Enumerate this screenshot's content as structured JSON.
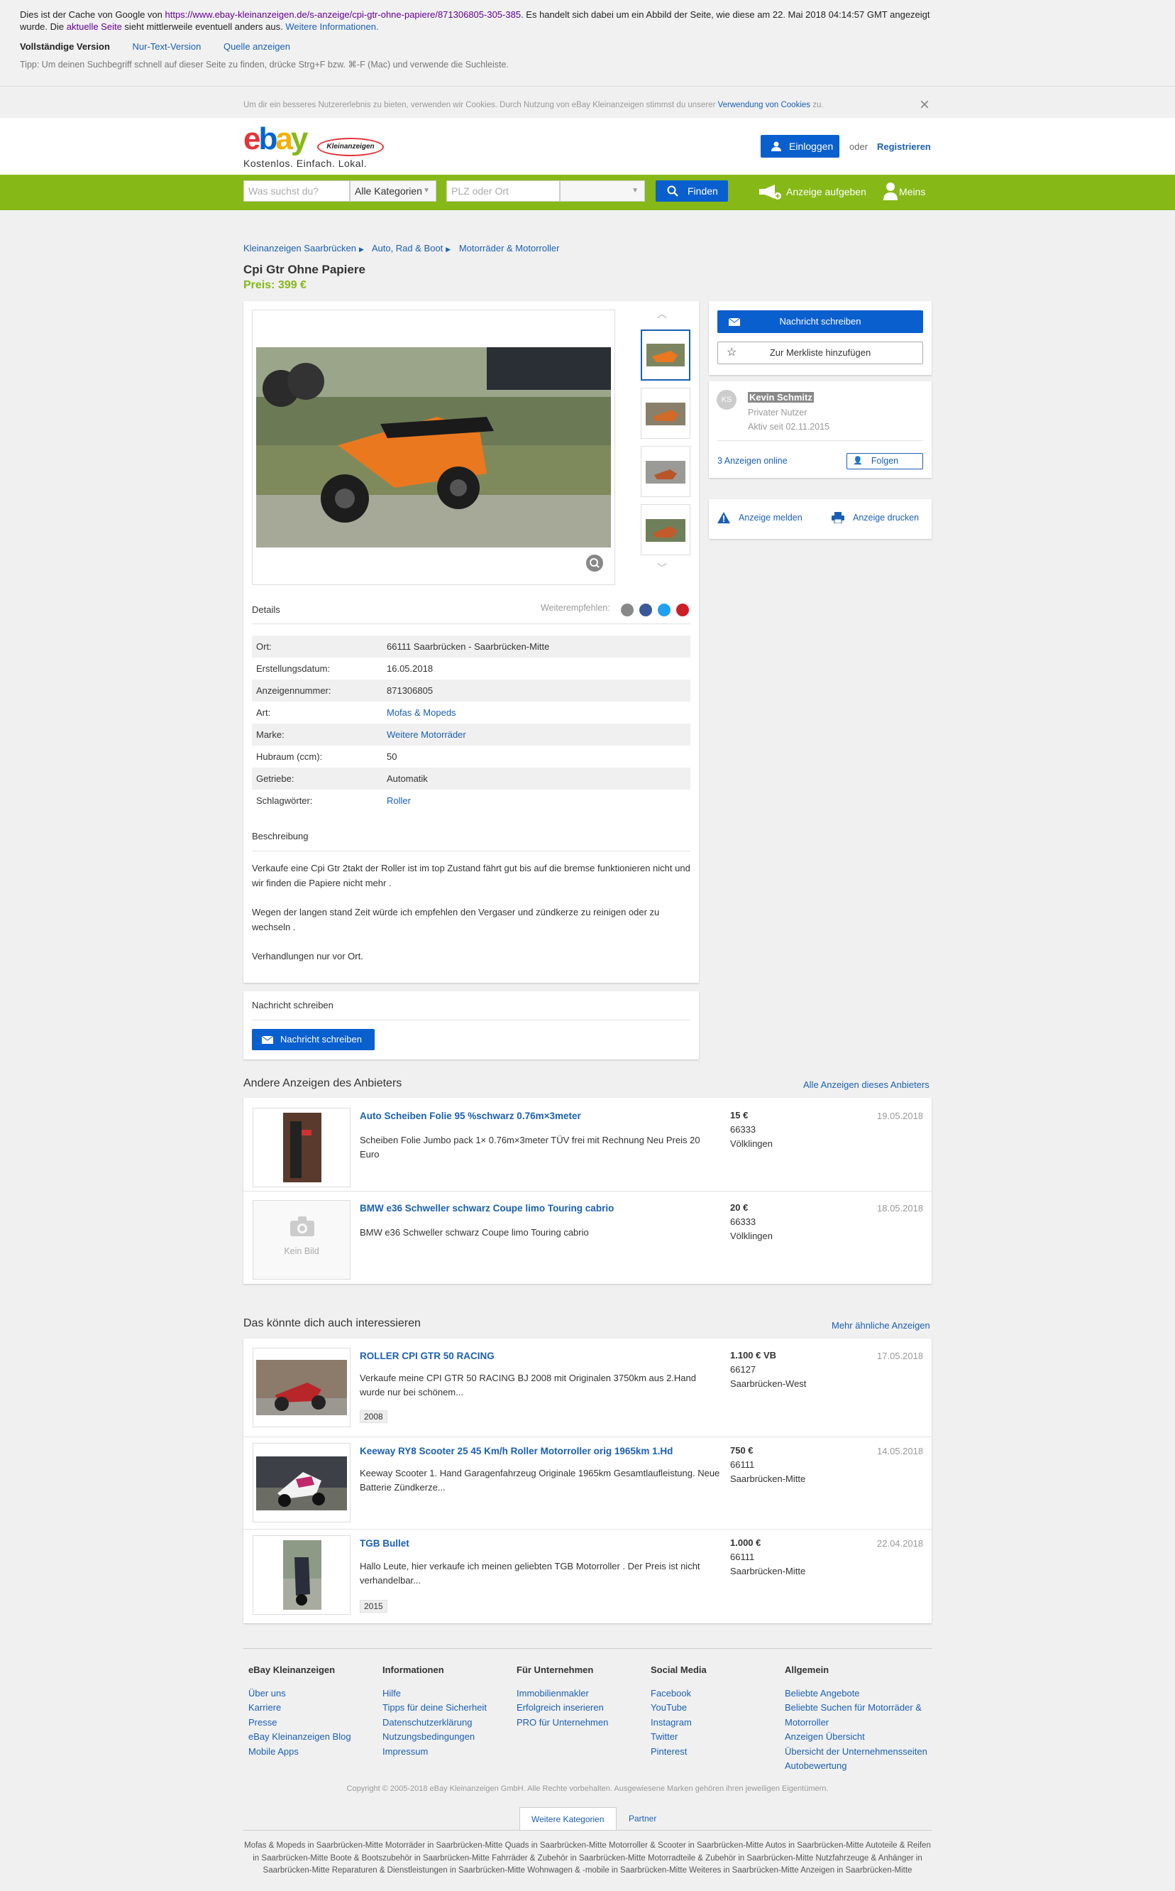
{
  "cache": {
    "line1_a": "Dies ist der Cache von Google von ",
    "url": "https://www.ebay-kleinanzeigen.de/s-anzeige/cpi-gtr-ohne-papiere/871306805-305-385",
    "line1_b": ". Es handelt sich dabei um ein Abbild der Seite, wie diese am 22. Mai 2018 04:14:57 GMT angezeigt wurde. Die ",
    "current_link": "aktuelle Seite",
    "line1_c": " sieht mittlerweile eventuell anders aus. ",
    "more_info": "Weitere Informationen.",
    "full_version": "Vollständige Version",
    "text_only": "Nur-Text-Version",
    "source": "Quelle anzeigen",
    "tip": "Tipp: Um deinen Suchbegriff schnell auf dieser Seite zu finden, drücke Strg+F bzw. ⌘-F (Mac) und verwende die Suchleiste."
  },
  "cookie": {
    "text": "Um dir ein besseres Nutzererlebnis zu bieten, verwenden wir Cookies. Durch Nutzung von eBay Kleinanzeigen stimmst du unserer ",
    "link": "Verwendung von Cookies",
    "end": " zu."
  },
  "header": {
    "logo_e": "e",
    "logo_b": "b",
    "logo_a": "a",
    "logo_y": "y",
    "logo_badge": "Kleinanzeigen",
    "slogan": "Kostenlos. Einfach. Lokal.",
    "login": "Einloggen",
    "oder": "oder",
    "register": "Registrieren"
  },
  "search": {
    "placeholder": "Was suchst du?",
    "category": "Alle Kategorien",
    "location_placeholder": "PLZ oder Ort",
    "find": "Finden",
    "post_ad": "Anzeige aufgeben",
    "mine": "Meins"
  },
  "breadcrumb": [
    "Kleinanzeigen Saarbrücken",
    "Auto, Rad & Boot",
    "Motorräder & Motorroller"
  ],
  "ad": {
    "title": "Cpi Gtr Ohne Papiere",
    "price": "Preis: 399 €",
    "details_label": "Details",
    "share_label": "Weiterempfehlen:",
    "details": [
      {
        "k": "Ort:",
        "v": "66111 Saarbrücken - Saarbrücken-Mitte",
        "link": false
      },
      {
        "k": "Erstellungsdatum:",
        "v": "16.05.2018",
        "link": false
      },
      {
        "k": "Anzeigennummer:",
        "v": "871306805",
        "link": false
      },
      {
        "k": "Art:",
        "v": "Mofas & Mopeds",
        "link": true
      },
      {
        "k": "Marke:",
        "v": "Weitere Motorräder",
        "link": true
      },
      {
        "k": "Hubraum (ccm):",
        "v": "50",
        "link": false
      },
      {
        "k": "Getriebe:",
        "v": "Automatik",
        "link": false
      },
      {
        "k": "Schlagwörter:",
        "v": "Roller",
        "link": true
      }
    ],
    "desc_label": "Beschreibung",
    "desc_p1": "Verkaufe eine Cpi Gtr 2takt der Roller ist im top Zustand fährt gut bis auf die bremse funktionieren nicht und wir finden die Papiere nicht mehr .",
    "desc_p2": "Wegen der langen stand Zeit würde ich empfehlen den Vergaser und zündkerze zu reinigen oder zu wechseln .",
    "desc_p3": "Verhandlungen nur vor Ort.",
    "msg_label": "Nachricht schreiben",
    "msg_button": "Nachricht schreiben"
  },
  "sidebar": {
    "send_message": "Nachricht schreiben",
    "watchlist": "Zur Merkliste hinzufügen",
    "seller_initials": "KS",
    "seller_name": "Kevin Schmitz",
    "seller_type": "Privater Nutzer",
    "seller_active": "Aktiv seit 02.11.2015",
    "ads_online": "3 Anzeigen online",
    "follow": "Folgen",
    "report": "Anzeige melden",
    "print": "Anzeige drucken"
  },
  "other_ads": {
    "title": "Andere Anzeigen des Anbieters",
    "all_link": "Alle Anzeigen dieses Anbieters",
    "no_image": "Kein Bild",
    "items": [
      {
        "title": "Auto Scheiben Folie 95 %schwarz 0.76m×3meter",
        "desc": "Scheiben Folie Jumbo pack 1× 0.76m×3meter TÜV frei mit Rechnung Neu Preis 20 Euro",
        "price": "15 €",
        "zip": "66333",
        "city": "Völklingen",
        "date": "19.05.2018"
      },
      {
        "title": "BMW e36 Schweller schwarz Coupe limo Touring cabrio",
        "desc": "BMW e36 Schweller schwarz Coupe limo Touring cabrio",
        "price": "20 €",
        "zip": "66333",
        "city": "Völklingen",
        "date": "18.05.2018"
      }
    ]
  },
  "similar": {
    "title": "Das könnte dich auch interessieren",
    "more_link": "Mehr ähnliche Anzeigen",
    "items": [
      {
        "title": "ROLLER CPI GTR 50 RACING",
        "desc": "Verkaufe meine CPI GTR 50 RACING BJ 2008 mit Originalen 3750km aus 2.Hand wurde nur bei schönem...",
        "tag": "2008",
        "price": "1.100 € VB",
        "zip": "66127",
        "city": "Saarbrücken-West",
        "date": "17.05.2018"
      },
      {
        "title": "Keeway RY8 Scooter 25 45 Km/h Roller Motorroller orig 1965km 1.Hd",
        "desc": "Keeway Scooter 1. Hand Garagenfahrzeug Originale 1965km Gesamtlaufleistung. Neue Batterie Zündkerze...",
        "tag": "",
        "price": "750 €",
        "zip": "66111",
        "city": "Saarbrücken-Mitte",
        "date": "14.05.2018"
      },
      {
        "title": "TGB Bullet",
        "desc": "Hallo Leute, hier verkaufe ich meinen geliebten TGB Motorroller . Der Preis ist nicht verhandelbar...",
        "tag": "2015",
        "price": "1.000 €",
        "zip": "66111",
        "city": "Saarbrücken-Mitte",
        "date": "22.04.2018"
      }
    ]
  },
  "footer": {
    "cols": [
      {
        "title": "eBay Kleinanzeigen",
        "links": [
          "Über uns",
          "Karriere",
          "Presse",
          "eBay Kleinanzeigen Blog",
          "Mobile Apps"
        ]
      },
      {
        "title": "Informationen",
        "links": [
          "Hilfe",
          "Tipps für deine Sicherheit",
          "Datenschutzerklärung",
          "Nutzungsbedingungen",
          "Impressum"
        ]
      },
      {
        "title": "Für Unternehmen",
        "links": [
          "Immobilienmakler",
          "Erfolgreich inserieren",
          "PRO für Unternehmen"
        ]
      },
      {
        "title": "Social Media",
        "links": [
          "Facebook",
          "YouTube",
          "Instagram",
          "Twitter",
          "Pinterest"
        ]
      },
      {
        "title": "Allgemein",
        "links": [
          "Beliebte Angebote",
          "Beliebte Suchen für Motorräder &",
          "Motorroller",
          "Anzeigen Übersicht",
          "Übersicht der Unternehmensseiten",
          "Autobewertung"
        ]
      }
    ],
    "copyright": "Copyright © 2005-2018 eBay Kleinanzeigen GmbH. Alle Rechte vorbehalten. Ausgewiesene Marken gehören ihren jeweiligen Eigentümern.",
    "tab_categories": "Weitere Kategorien",
    "tab_partner": "Partner",
    "categories": "Mofas & Mopeds in Saarbrücken-Mitte     Motorräder in Saarbrücken-Mitte     Quads in Saarbrücken-Mitte     Motorroller & Scooter in Saarbrücken-Mitte     Autos in Saarbrücken-Mitte     Autoteile & Reifen in Saarbrücken-Mitte     Boote & Bootszubehör in Saarbrücken-Mitte     Fahrräder & Zubehör in Saarbrücken-Mitte     Motorradteile & Zubehör in Saarbrücken-Mitte     Nutzfahrzeuge & Anhänger in Saarbrücken-Mitte     Reparaturen & Dienstleistungen in Saarbrücken-Mitte     Wohnwagen & -mobile in Saarbrücken-Mitte     Weiteres in Saarbrücken-Mitte     Anzeigen in Saarbrücken-Mitte"
  },
  "colors": {
    "green": "#86b817",
    "blue": "#0a5fce",
    "link": "#1a5fb4"
  }
}
